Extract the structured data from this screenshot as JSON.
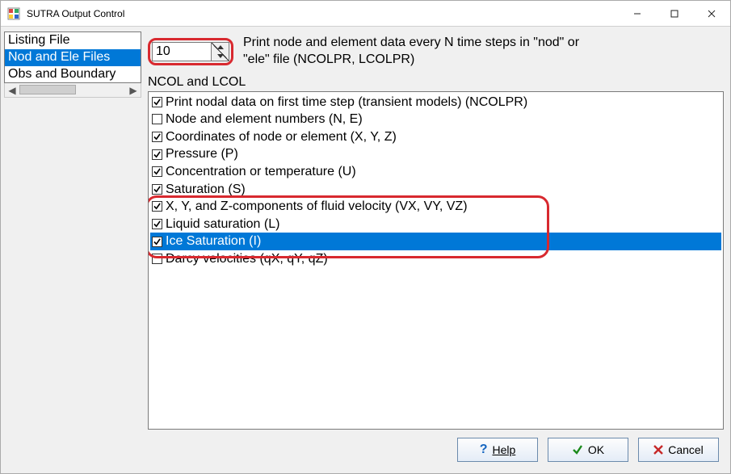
{
  "window": {
    "title": "SUTRA Output Control"
  },
  "sidebar": {
    "items": [
      {
        "label": "Listing File",
        "selected": false
      },
      {
        "label": "Nod and Ele Files",
        "selected": true
      },
      {
        "label": "Obs and Boundary",
        "selected": false
      }
    ]
  },
  "main": {
    "spin_value": "10",
    "desc_line1": "Print node and element data every N time steps in \"nod\" or",
    "desc_line2": "\"ele\" file (NCOLPR, LCOLPR)",
    "group_label": "NCOL and LCOL",
    "options": [
      {
        "label": "Print nodal data on first time step (transient models) (NCOLPR)",
        "checked": true,
        "selected": false
      },
      {
        "label": "Node and element numbers (N, E)",
        "checked": false,
        "selected": false
      },
      {
        "label": "Coordinates of node or element (X, Y, Z)",
        "checked": true,
        "selected": false
      },
      {
        "label": "Pressure (P)",
        "checked": true,
        "selected": false
      },
      {
        "label": "Concentration or temperature (U)",
        "checked": true,
        "selected": false
      },
      {
        "label": "Saturation (S)",
        "checked": true,
        "selected": false
      },
      {
        "label": "X, Y, and Z-components of fluid velocity (VX, VY, VZ)",
        "checked": true,
        "selected": false
      },
      {
        "label": "Liquid saturation (L)",
        "checked": true,
        "selected": false
      },
      {
        "label": "Ice Saturation (I)",
        "checked": true,
        "selected": true
      },
      {
        "label": "Darcy velocities (qX, qY, qZ)",
        "checked": false,
        "selected": false
      }
    ]
  },
  "buttons": {
    "help": "Help",
    "ok": "OK",
    "cancel": "Cancel"
  }
}
